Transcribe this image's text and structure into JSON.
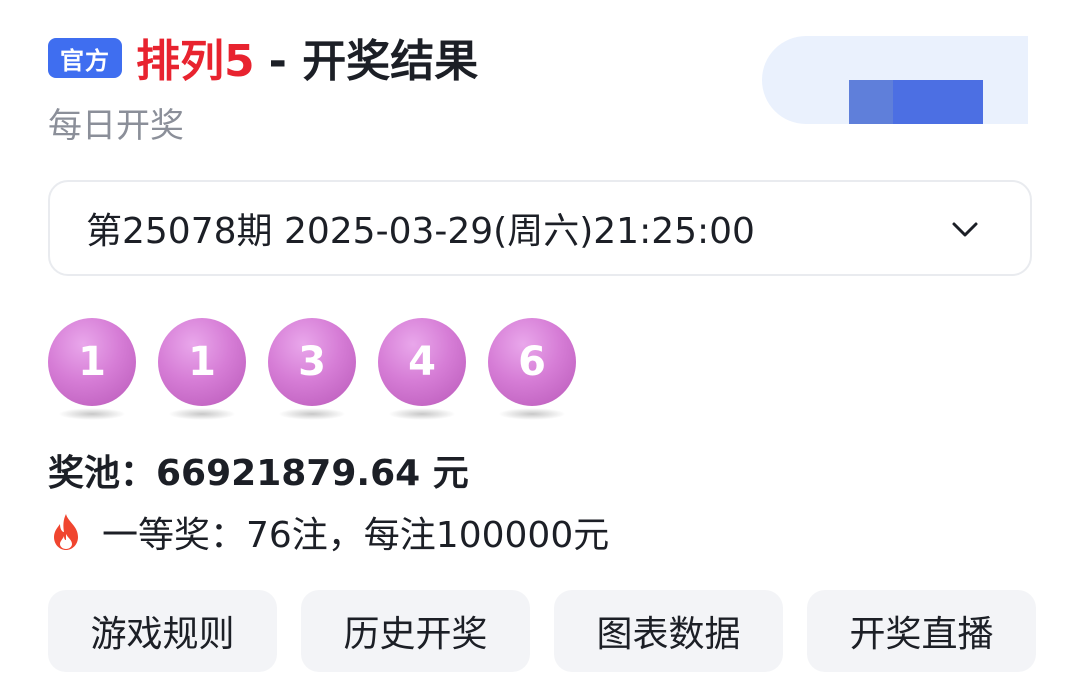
{
  "header": {
    "badge": "官方",
    "game_name": "排列5",
    "title_suffix": "- 开奖结果",
    "subtitle": "每日开奖"
  },
  "draw_selector": {
    "value": "第25078期 2025-03-29(周六)21:25:00",
    "icon": "chevron-down-icon"
  },
  "balls": [
    "1",
    "1",
    "3",
    "4",
    "6"
  ],
  "pool": {
    "text": "奖池：66921879.64 元"
  },
  "first_prize": {
    "icon": "fire-icon",
    "text": "一等奖：76注，每注100000元"
  },
  "actions": [
    {
      "label": "游戏规则"
    },
    {
      "label": "历史开奖"
    },
    {
      "label": "图表数据"
    },
    {
      "label": "开奖直播"
    }
  ],
  "colors": {
    "accent_red": "#e8232f",
    "badge_blue": "#3f6ef0",
    "ball_purple": "#d67dd6"
  }
}
